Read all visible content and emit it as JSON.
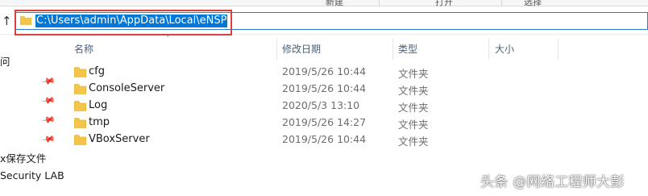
{
  "ribbon": {
    "labels": [
      "新建",
      "打开",
      "选择"
    ]
  },
  "address_bar": {
    "path": "C:\\Users\\admin\\AppData\\Local\\eNSP",
    "icon": "folder-icon",
    "up_icon": "up-arrow-icon"
  },
  "nav": {
    "items": [
      "问",
      "x保存文件",
      "Security LAB"
    ]
  },
  "columns": {
    "name": "名称",
    "date": "修改日期",
    "type": "类型",
    "size": "大小"
  },
  "files": [
    {
      "name": "cfg",
      "date": "2019/5/26 10:44",
      "type": "文件夹"
    },
    {
      "name": "ConsoleServer",
      "date": "2019/5/26 10:44",
      "type": "文件夹"
    },
    {
      "name": "Log",
      "date": "2020/5/3 13:10",
      "type": "文件夹"
    },
    {
      "name": "tmp",
      "date": "2019/5/26 14:27",
      "type": "文件夹"
    },
    {
      "name": "VBoxServer",
      "date": "2019/5/26 10:44",
      "type": "文件夹"
    }
  ],
  "watermark": "头条 @网络工程师大彭",
  "colors": {
    "selection": "#0078d7",
    "highlight_border": "#d94141",
    "folder": "#f3c54b"
  }
}
